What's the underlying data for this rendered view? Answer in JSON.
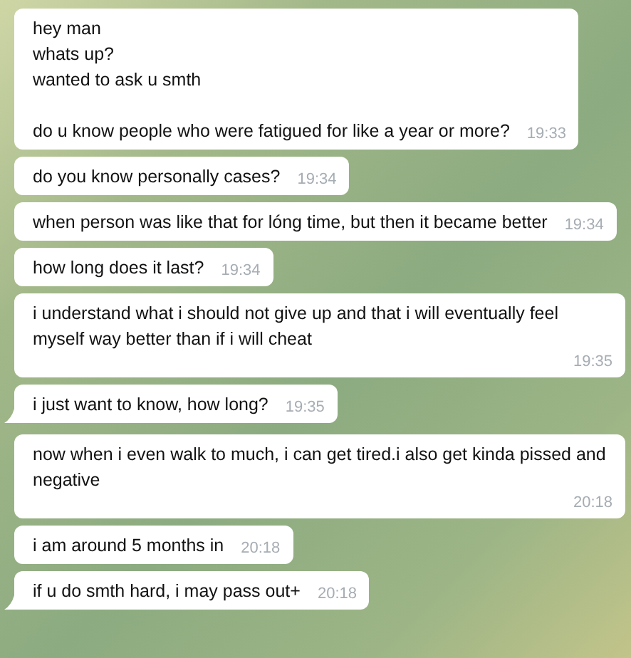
{
  "messages": [
    {
      "text": "hey man\nwhats up?\nwanted to ask u smth\n\ndo u know people who were fatigued for like a year or more?",
      "time": "19:33",
      "tail": false
    },
    {
      "text": "do you know personally cases?",
      "time": "19:34",
      "tail": false
    },
    {
      "text": "when person was like that for lóng time, but then it became better",
      "time": "19:34",
      "tail": false
    },
    {
      "text": "how long does it last?",
      "time": "19:34",
      "tail": false
    },
    {
      "text": "i understand what i should not give up and that i will eventually feel myself way better than if i will cheat",
      "time": "19:35",
      "tail": false
    },
    {
      "text": "i just want to know, how long?",
      "time": "19:35",
      "tail": true
    },
    {
      "text": "now when i even walk to much, i can get tired.i also get kinda pissed and negative",
      "time": "20:18",
      "tail": false
    },
    {
      "text": "i am around 5 months in",
      "time": "20:18",
      "tail": false
    },
    {
      "text": "if u do smth hard, i may pass out+",
      "time": "20:18",
      "tail": true
    }
  ]
}
